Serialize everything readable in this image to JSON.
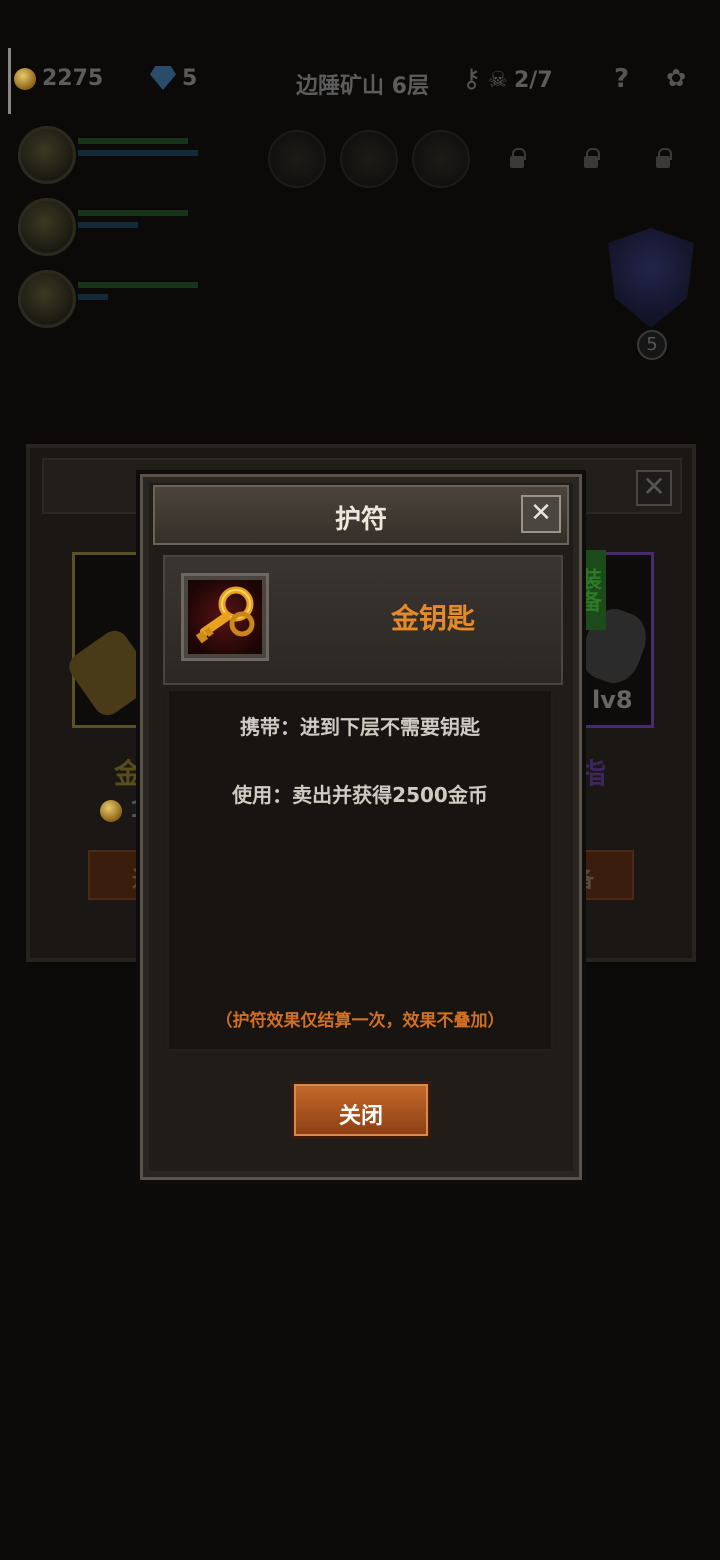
{
  "hud": {
    "gold": "2275",
    "gems": "5",
    "location": "边陲矿山 6层",
    "skull_count": "2/7",
    "help": "?"
  },
  "side": {
    "level_badge": "5"
  },
  "background_shop": {
    "item_left_name_partial": "金",
    "item_left_cost_partial": "1",
    "item_right_name_partial": "指",
    "item_right_level": "lv8",
    "equip_label": "装备",
    "btn_left_partial": "进",
    "btn_right_partial": "备"
  },
  "modal": {
    "title": "护符",
    "close_glyph": "✕",
    "item_name": "金钥匙",
    "item_icon": "golden-key-icon",
    "carry_text": "携带：进到下层不需要钥匙",
    "use_text": "使用：卖出并获得2500金币",
    "note_text": "（护符效果仅结算一次，效果不叠加）",
    "close_button_label": "关闭"
  }
}
